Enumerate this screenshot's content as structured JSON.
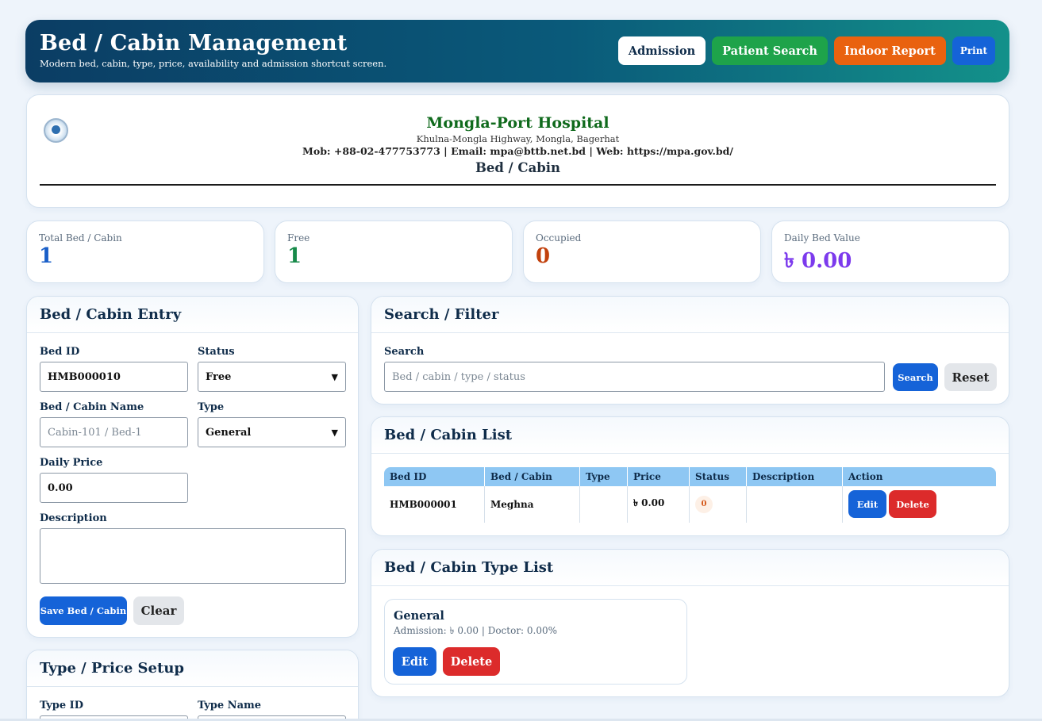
{
  "header": {
    "title": "Bed / Cabin Management",
    "subtitle": "Modern bed, cabin, type, price, availability and admission shortcut screen.",
    "buttons": {
      "admission": "Admission",
      "patient_search": "Patient Search",
      "indoor_report": "Indoor Report",
      "print": "Print"
    }
  },
  "hospital": {
    "name": "Mongla-Port Hospital",
    "address": "Khulna-Mongla Highway, Mongla, Bagerhat",
    "contact": "Mob: +88-02-477753773 | Email: mpa@bttb.net.bd | Web: https://mpa.gov.bd/",
    "page_title": "Bed / Cabin"
  },
  "stats": [
    {
      "label": "Total Bed / Cabin",
      "value": "1",
      "color": "#1a5fc8"
    },
    {
      "label": "Free",
      "value": "1",
      "color": "#178a4a"
    },
    {
      "label": "Occupied",
      "value": "0",
      "color": "#c2410c"
    },
    {
      "label": "Daily Bed Value",
      "value": "৳ 0.00",
      "color": "#7c3aed"
    }
  ],
  "entry": {
    "title": "Bed / Cabin Entry",
    "bed_id_label": "Bed ID",
    "bed_id_value": "HMB000010",
    "status_label": "Status",
    "status_value": "Free",
    "name_label": "Bed / Cabin Name",
    "name_placeholder": "Cabin-101 / Bed-1",
    "type_label": "Type",
    "type_value": "General",
    "price_label": "Daily Price",
    "price_value": "0.00",
    "desc_label": "Description",
    "save_label": "Save Bed / Cabin",
    "clear_label": "Clear"
  },
  "type_setup": {
    "title": "Type / Price Setup",
    "type_id_label": "Type ID",
    "type_name_label": "Type Name"
  },
  "search": {
    "title": "Search / Filter",
    "label": "Search",
    "placeholder": "Bed / cabin / type / status",
    "search_label": "Search",
    "reset_label": "Reset"
  },
  "list": {
    "title": "Bed / Cabin List",
    "columns": [
      "Bed ID",
      "Bed / Cabin",
      "Type",
      "Price",
      "Status",
      "Description",
      "Action"
    ],
    "rows": [
      {
        "bed_id": "HMB000001",
        "name": "Meghna",
        "type": "",
        "price": "৳ 0.00",
        "status": "0",
        "description": "",
        "edit": "Edit",
        "delete": "Delete"
      }
    ]
  },
  "type_list": {
    "title": "Bed / Cabin Type List",
    "items": [
      {
        "name": "General",
        "desc": "Admission: ৳ 0.00 | Doctor: 0.00%",
        "edit": "Edit",
        "delete": "Delete"
      }
    ]
  }
}
